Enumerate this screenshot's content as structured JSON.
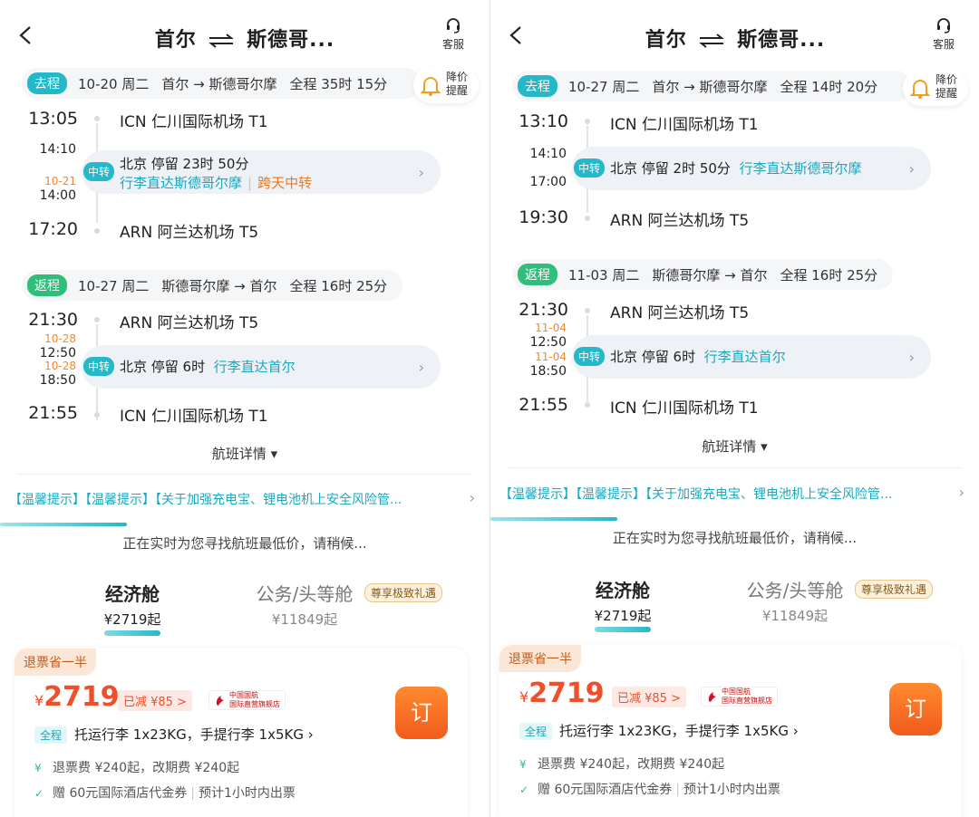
{
  "panels": [
    {
      "header": {
        "title": "首尔 ⇄ 斯德哥...",
        "title_from": "首尔",
        "title_to": "斯德哥...",
        "service": "客服"
      },
      "bell": {
        "l1": "降价",
        "l2": "提醒"
      },
      "outbound": {
        "tag": "去程",
        "date": "10-20 周二",
        "route": "首尔 → 斯德哥尔摩",
        "duration": "全程 35时 15分",
        "dep_time": "13:05",
        "dep_airport": "ICN 仁川国际机场 T1",
        "stop_arr_time": "14:10",
        "stop_dep_date": "10-21",
        "stop_dep_time": "14:00",
        "stop_tag": "中转",
        "stop_line1": "北京  停留 23时 50分",
        "stop_line2": "行李直达斯德哥尔摩",
        "stop_extra": "跨天中转",
        "arr_time": "17:20",
        "arr_airport": "ARN 阿兰达机场 T5"
      },
      "return": {
        "tag": "返程",
        "date": "10-27 周二",
        "route": "斯德哥尔摩 → 首尔",
        "duration": "全程 16时 25分",
        "dep_time": "21:30",
        "dep_airport": "ARN 阿兰达机场 T5",
        "stop_arr_date": "10-28",
        "stop_arr_time": "12:50",
        "stop_dep_date": "10-28",
        "stop_dep_time": "18:50",
        "stop_tag": "中转",
        "stop_city": "北京  停留 6时",
        "stop_bag": "行李直达首尔",
        "arr_time": "21:55",
        "arr_airport": "ICN 仁川国际机场 T1"
      },
      "detail": "航班详情 ▾",
      "notice": "【温馨提示】【温馨提示】【关于加强充电宝、锂电池机上安全风险管...",
      "searching": "正在实时为您寻找航班最低价，请稍候...",
      "cabins": [
        {
          "name": "经济舱",
          "price": "¥2719起"
        },
        {
          "name": "公务/头等舱",
          "price": "¥11849起",
          "badge": "尊享极致礼遇"
        }
      ],
      "card": {
        "half": "退票省一半",
        "yen": "¥",
        "price": "2719",
        "cut": "已减 ¥85 >",
        "airline_cn": "中国国航",
        "airline_sub": "国际直营旗舰店",
        "book": "订",
        "full": "全程",
        "luggage": "托运行李 1x23KG，手提行李 1x5KG ›",
        "refund": "退票费 ¥240起，改期费 ¥240起",
        "gift": "赠 60元国际酒店代金券",
        "ticket": "预计1小时内出票"
      }
    },
    {
      "header": {
        "title": "首尔 ⇄ 斯德哥...",
        "title_from": "首尔",
        "title_to": "斯德哥...",
        "service": "客服"
      },
      "bell": {
        "l1": "降价",
        "l2": "提醒"
      },
      "outbound": {
        "tag": "去程",
        "date": "10-27 周二",
        "route": "首尔 → 斯德哥尔摩",
        "duration": "全程 14时 20分",
        "dep_time": "13:10",
        "dep_airport": "ICN 仁川国际机场 T1",
        "stop_arr_time": "14:10",
        "stop_dep_time": "17:00",
        "stop_tag": "中转",
        "stop_line1": "北京  停留 2时 50分",
        "stop_bag": "行李直达斯德哥尔摩",
        "arr_time": "19:30",
        "arr_airport": "ARN 阿兰达机场 T5"
      },
      "return": {
        "tag": "返程",
        "date": "11-03 周二",
        "route": "斯德哥尔摩 → 首尔",
        "duration": "全程 16时 25分",
        "dep_time": "21:30",
        "dep_airport": "ARN 阿兰达机场 T5",
        "stop_arr_date": "11-04",
        "stop_arr_time": "12:50",
        "stop_dep_date": "11-04",
        "stop_dep_time": "18:50",
        "stop_tag": "中转",
        "stop_city": "北京  停留 6时",
        "stop_bag": "行李直达首尔",
        "arr_time": "21:55",
        "arr_airport": "ICN 仁川国际机场 T1"
      },
      "detail": "航班详情 ▾",
      "notice": "【温馨提示】【温馨提示】【关于加强充电宝、锂电池机上安全风险管...",
      "searching": "正在实时为您寻找航班最低价，请稍候...",
      "cabins": [
        {
          "name": "经济舱",
          "price": "¥2719起"
        },
        {
          "name": "公务/头等舱",
          "price": "¥11849起",
          "badge": "尊享极致礼遇"
        }
      ],
      "card": {
        "half": "退票省一半",
        "yen": "¥",
        "price": "2719",
        "cut": "已减 ¥85 >",
        "airline_cn": "中国国航",
        "airline_sub": "国际直营旗舰店",
        "book": "订",
        "full": "全程",
        "luggage": "托运行李 1x23KG，手提行李 1x5KG ›",
        "refund": "退票费 ¥240起，改期费 ¥240起",
        "gift": "赠 60元国际酒店代金券",
        "ticket": "预计1小时内出票"
      }
    }
  ],
  "colors": {
    "accent": "#24b8c9",
    "return_tag": "#2fbf7a",
    "price": "#ef4f2a",
    "overnight": "#f0781e"
  }
}
